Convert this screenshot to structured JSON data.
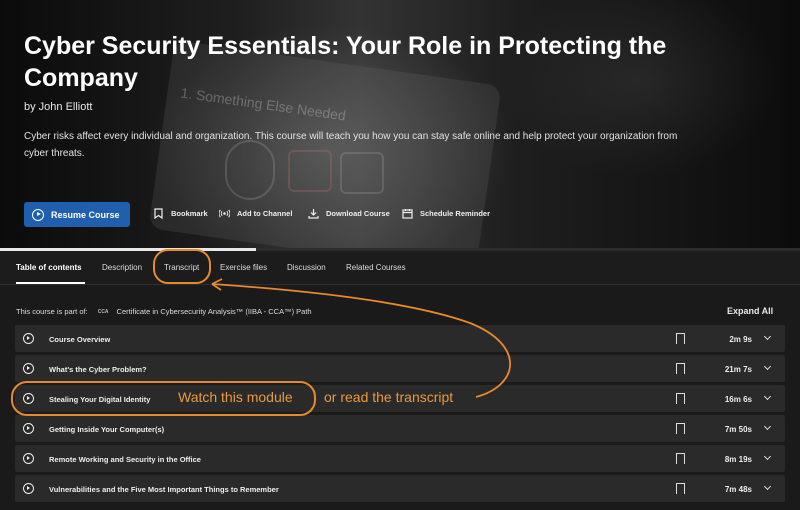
{
  "course": {
    "title": "Cyber Security Essentials: Your Role in Protecting the Company",
    "author": "by John Elliott",
    "description": "Cyber risks affect every individual and organization. This course will teach you how you can stay safe online and help protect your organization from cyber threats.",
    "hero_image_text": "1. Something Else Needed",
    "progress_fraction": 0.32
  },
  "actions": {
    "resume": "Resume Course",
    "bookmark": "Bookmark",
    "add_to_channel": "Add to Channel",
    "download": "Download Course",
    "schedule": "Schedule Reminder"
  },
  "tabs": [
    {
      "label": "Table of contents",
      "active": true
    },
    {
      "label": "Description",
      "active": false
    },
    {
      "label": "Transcript",
      "active": false
    },
    {
      "label": "Exercise files",
      "active": false
    },
    {
      "label": "Discussion",
      "active": false
    },
    {
      "label": "Related Courses",
      "active": false
    }
  ],
  "path": {
    "prefix": "This course is part of:",
    "logo": "CCA",
    "name": "Certificate in Cybersecurity Analysis™ (IIBA - CCA™) Path"
  },
  "expand_all": "Expand All",
  "modules": [
    {
      "title": "Course Overview",
      "duration": "2m 9s"
    },
    {
      "title": "What's the Cyber Problem?",
      "duration": "21m 7s"
    },
    {
      "title": "Stealing Your Digital Identity",
      "duration": "16m 6s"
    },
    {
      "title": "Getting Inside Your Computer(s)",
      "duration": "7m 50s"
    },
    {
      "title": "Remote Working and Security in the Office",
      "duration": "8m 19s"
    },
    {
      "title": "Vulnerabilities and the Five Most Important Things to Remember",
      "duration": "7m 48s"
    }
  ],
  "annotations": {
    "watch": "Watch this module",
    "read": "or read the transcript",
    "color": "#e8892c"
  },
  "colors": {
    "accent_button": "#1f5fae",
    "row_bg": "#2a2a2a",
    "page_bg": "#1b1b1b"
  }
}
